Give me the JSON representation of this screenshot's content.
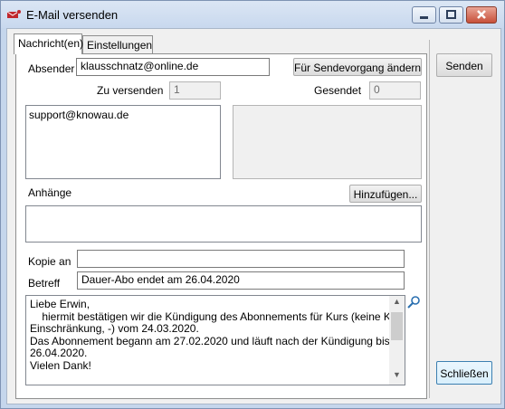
{
  "window": {
    "title": "E-Mail versenden"
  },
  "tabs": [
    {
      "label": "Nachricht(en)"
    },
    {
      "label": "Einstellungen"
    }
  ],
  "form": {
    "absender_label": "Absender",
    "absender_value": "klausschnatz@online.de",
    "change_sender_button": "Für Sendevorgang ändern",
    "zu_versenden_label": "Zu versenden",
    "zu_versenden_value": "1",
    "gesendet_label": "Gesendet",
    "gesendet_value": "0",
    "recipients": [
      "support@knowau.de"
    ],
    "anhaenge_label": "Anhänge",
    "hinzufuegen_button": "Hinzufügen...",
    "kopie_label": "Kopie an",
    "kopie_value": "",
    "betreff_label": "Betreff",
    "betreff_value": "Dauer-Abo endet am 26.04.2020",
    "body_lines": [
      "Liebe Erwin,",
      "",
      "    hiermit bestätigen wir die Kündigung des Abonnements für Kurs (keine Kurs-",
      "Einschränkung, -) vom 24.03.2020.",
      "Das Abonnement begann am 27.02.2020 und läuft nach der Kündigung bis zum",
      "26.04.2020.",
      "Vielen Dank!"
    ]
  },
  "side": {
    "senden_button": "Senden",
    "schliessen_button": "Schließen"
  },
  "icons": {
    "app": "envelope-icon",
    "zoom": "magnifier-icon"
  }
}
